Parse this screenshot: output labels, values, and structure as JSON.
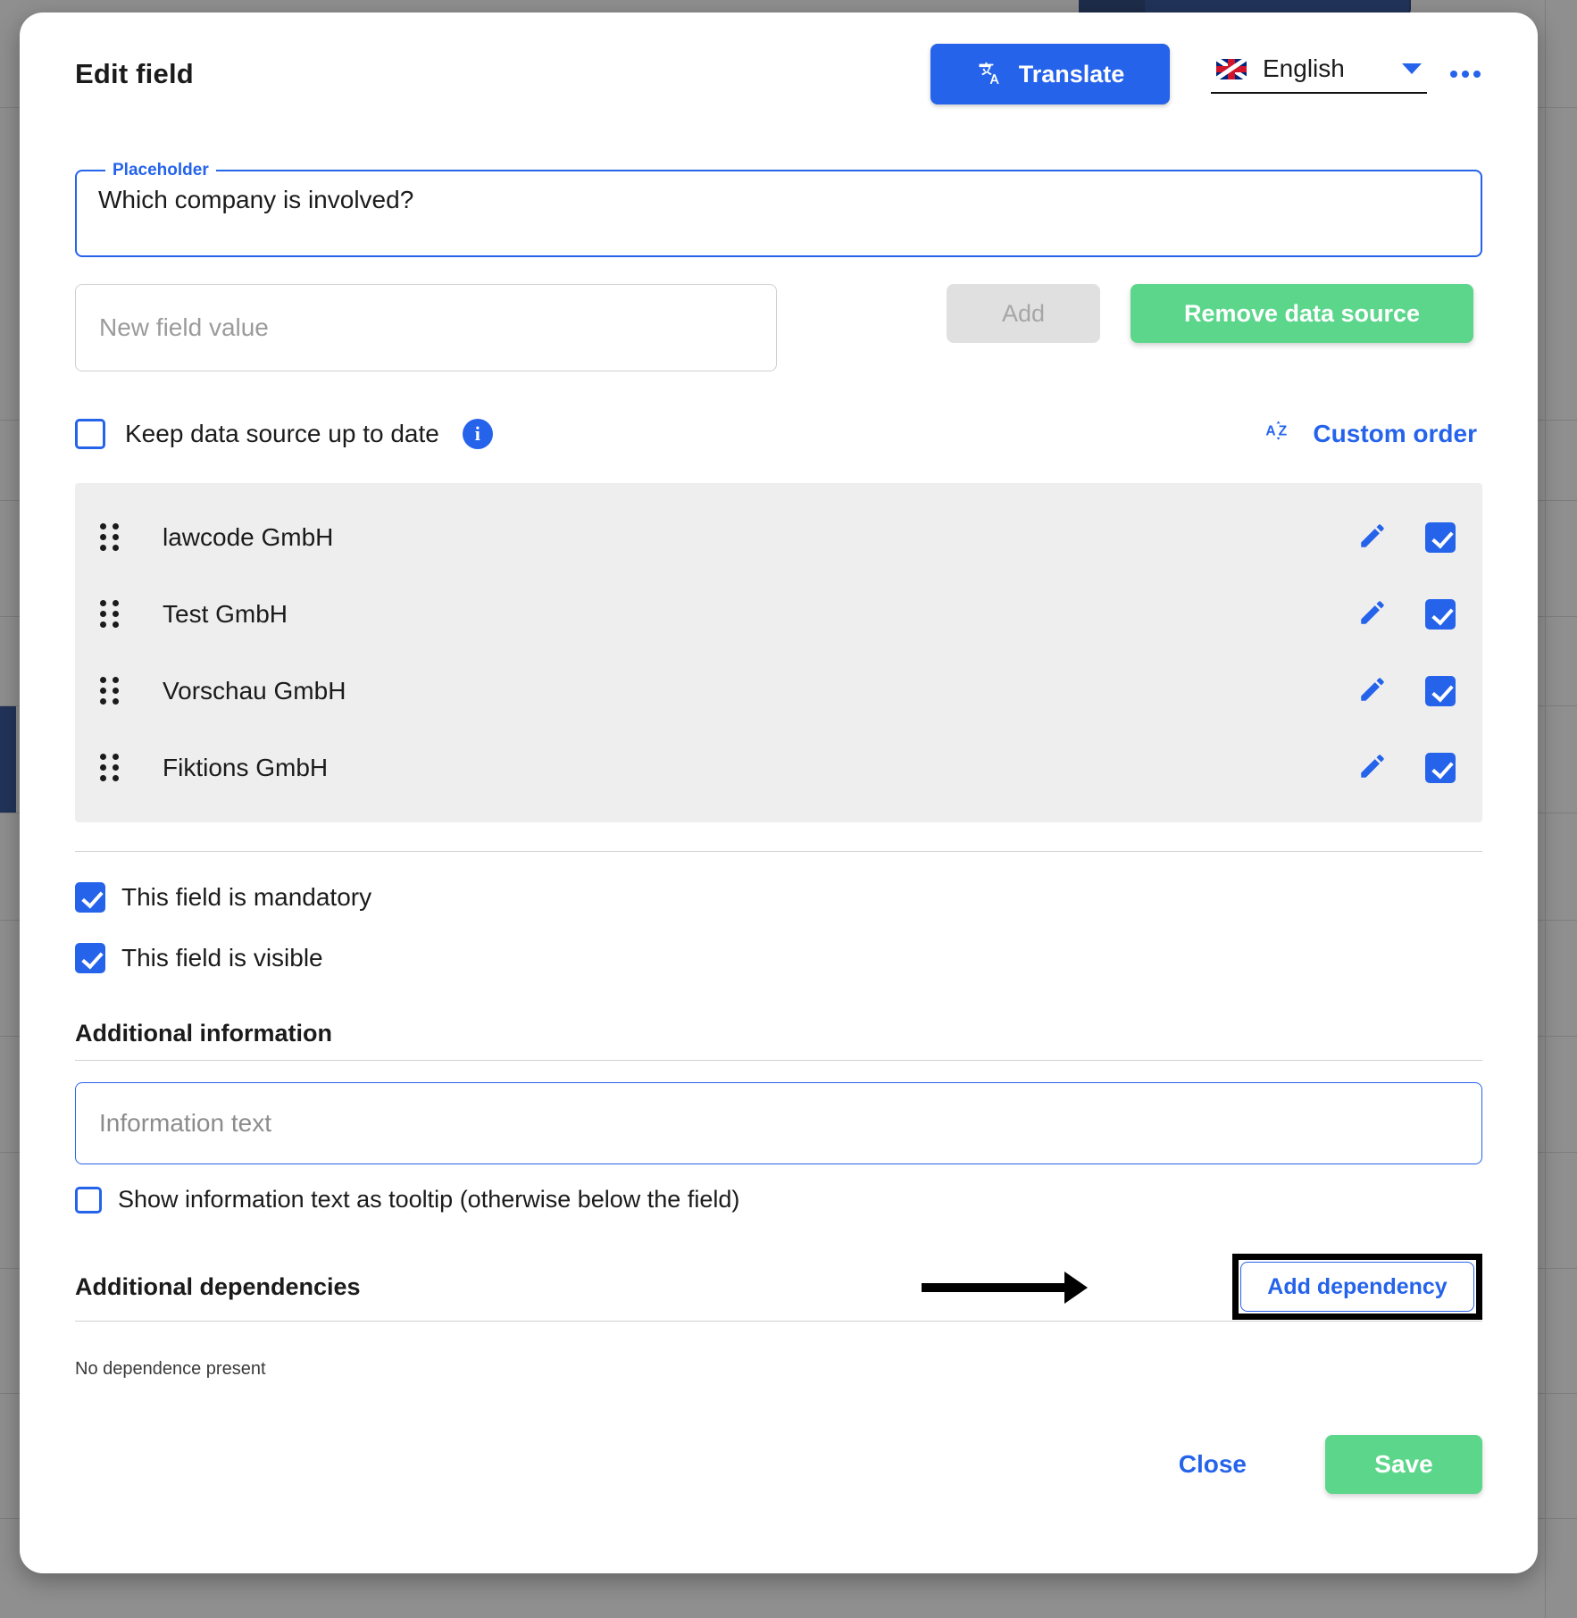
{
  "modal": {
    "title": "Edit field",
    "header": {
      "translate_button": "Translate",
      "translate_icon": "translate-icon",
      "language": "English",
      "flag_icon": "uk-flag-icon",
      "caret_icon": "chevron-down-icon",
      "overflow_icon": "more-options-icon"
    },
    "placeholder_field": {
      "legend": "Placeholder",
      "value": "Which company is involved?"
    },
    "new_value_row": {
      "input_placeholder": "New field value",
      "input_value": "",
      "add_label": "Add",
      "remove_label": "Remove data source"
    },
    "keep_row": {
      "label": "Keep data source up to date",
      "checked": false,
      "info_icon": "info-icon",
      "custom_order_label": "Custom order",
      "sort_icon": "sort-az-icon"
    },
    "list": {
      "items": [
        {
          "label": "lawcode GmbH",
          "checked": true
        },
        {
          "label": "Test GmbH",
          "checked": true
        },
        {
          "label": "Vorschau GmbH",
          "checked": true
        },
        {
          "label": "Fiktions GmbH",
          "checked": true
        }
      ],
      "drag_icon": "drag-handle-icon",
      "edit_icon": "pencil-edit-icon"
    },
    "flags": [
      {
        "label": "This field is mandatory",
        "checked": true
      },
      {
        "label": "This field is visible",
        "checked": true
      }
    ],
    "additional_information": {
      "title": "Additional information",
      "input_placeholder": "Information text",
      "input_value": "",
      "tooltip_label": "Show information text as tooltip (otherwise below the field)",
      "tooltip_checked": false
    },
    "dependencies": {
      "title": "Additional dependencies",
      "add_label": "Add dependency",
      "empty_text": "No dependence present",
      "annotation_icon": "arrow-pointer-annotation"
    },
    "footer": {
      "close_label": "Close",
      "save_label": "Save"
    }
  },
  "colors": {
    "primary_blue": "#2563eb",
    "green": "#5bd68b",
    "disabled_gray": "#e0e0e0",
    "list_bg": "#eeeeee",
    "navy": "#12306e",
    "overlay": "rgba(40,40,40,0.52)"
  }
}
